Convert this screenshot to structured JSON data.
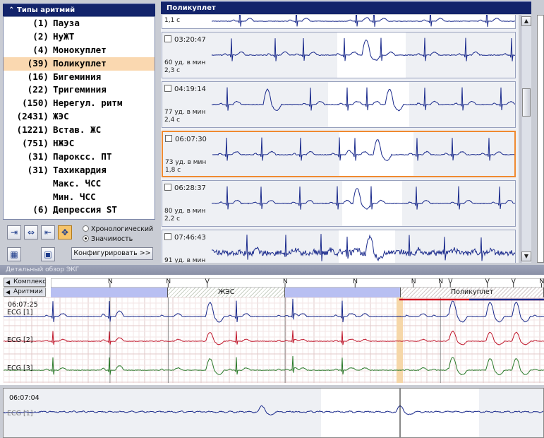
{
  "left_panel": {
    "title": "Типы аритмий",
    "items": [
      {
        "count": "(1)",
        "name": "Пауза"
      },
      {
        "count": "(2)",
        "name": "НуЖТ"
      },
      {
        "count": "(4)",
        "name": "Монокуплет"
      },
      {
        "count": "(39)",
        "name": "Поликуплет",
        "selected": true
      },
      {
        "count": "(16)",
        "name": "Бигеминия"
      },
      {
        "count": "(22)",
        "name": "Тригеминия"
      },
      {
        "count": "(150)",
        "name": "Нерегул. ритм"
      },
      {
        "count": "(2431)",
        "name": "ЖЭС"
      },
      {
        "count": "(1221)",
        "name": "Встав. ЖС"
      },
      {
        "count": "(751)",
        "name": "НЖЭС"
      },
      {
        "count": "(31)",
        "name": "Пароксс. ПТ"
      },
      {
        "count": "(31)",
        "name": "Тахикардия"
      },
      {
        "count": "",
        "name": "Макс. ЧСС"
      },
      {
        "count": "",
        "name": "Мин. ЧСС"
      },
      {
        "count": "(6)",
        "name": "Депрессия ST"
      }
    ],
    "sort_options": [
      "Хронологический",
      "Значимость"
    ],
    "sort_selected": "Значимость",
    "configure_label": "Конфигурировать >>"
  },
  "strips_panel": {
    "title": "Поликуплет",
    "top_partial": {
      "duration": "1,1 с"
    },
    "strips": [
      {
        "time": "03:20:47",
        "hr": "60 уд. в мин",
        "duration": "2,3 с",
        "selected": false
      },
      {
        "time": "04:19:14",
        "hr": "77 уд. в мин",
        "duration": "2,4 с",
        "selected": false
      },
      {
        "time": "06:07:30",
        "hr": "73 уд. в мин",
        "duration": "1,8 с",
        "selected": true
      },
      {
        "time": "06:28:37",
        "hr": "80 уд. в мин",
        "duration": "2,2 с",
        "selected": false
      },
      {
        "time": "07:46:43",
        "hr": "91 уд. в мин",
        "duration": "",
        "selected": false
      }
    ]
  },
  "detail_panel": {
    "title": "Детальный обзор ЭКГ",
    "row_complex": "Комплекс",
    "row_rhythm": "Аритмии",
    "beat_labels": [
      {
        "t": 0.12,
        "label": "N"
      },
      {
        "t": 0.238,
        "label": "N"
      },
      {
        "t": 0.317,
        "label": "V"
      },
      {
        "t": 0.475,
        "label": "N"
      },
      {
        "t": 0.617,
        "label": "N"
      },
      {
        "t": 0.735,
        "label": "N"
      },
      {
        "t": 0.79,
        "label": "N"
      },
      {
        "t": 0.81,
        "label": "V"
      },
      {
        "t": 0.885,
        "label": "V"
      },
      {
        "t": 0.938,
        "label": "V"
      },
      {
        "t": 0.995,
        "label": "N"
      }
    ],
    "rhythm_segments": [
      {
        "start": 0.0,
        "end": 0.238,
        "style": "blue",
        "label": ""
      },
      {
        "start": 0.238,
        "end": 0.475,
        "style": "hatch",
        "label": "ЖЭС"
      },
      {
        "start": 0.475,
        "end": 0.71,
        "style": "blue",
        "label": ""
      },
      {
        "start": 0.71,
        "end": 1.0,
        "style": "hatch2",
        "label": "Поликуплет"
      }
    ],
    "time": "06:07:25",
    "channels": [
      "ECG [1]",
      "ECG [2]",
      "ECG [3]"
    ],
    "channel_colors": [
      "#1a2a8c",
      "#c0182c",
      "#2a7a2a"
    ]
  },
  "bottom_panel": {
    "time": "06:07:04",
    "channel": "ECG [1]"
  }
}
